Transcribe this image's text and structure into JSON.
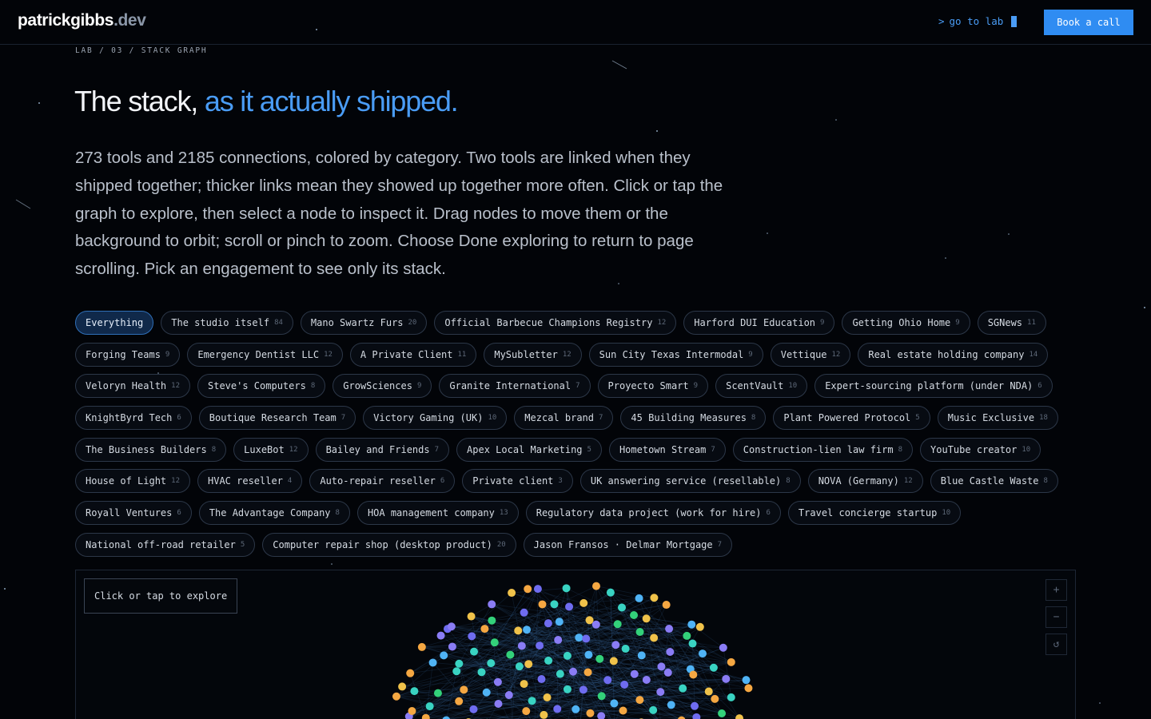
{
  "brand": {
    "name": "patrickgibbs",
    "tld": ".dev"
  },
  "nav": {
    "prompt": ">",
    "command": "go to lab",
    "cta": "Book a call"
  },
  "breadcrumb": "LAB / 03 / STACK GRAPH",
  "hero": {
    "title_main": "The stack, ",
    "title_accent": "as it actually shipped.",
    "description": "273 tools and 2185 connections, colored by category. Two tools are linked when they shipped together; thicker links mean they showed up together more often. Click or tap the graph to explore, then select a node to inspect it. Drag nodes to move them or the background to orbit; scroll or pinch to zoom. Choose Done exploring to return to page scrolling. Pick an engagement to see only its stack."
  },
  "filters": [
    {
      "label": "Everything",
      "count": "",
      "active": true
    },
    {
      "label": "The studio itself",
      "count": "84"
    },
    {
      "label": "Mano Swartz Furs",
      "count": "20"
    },
    {
      "label": "Official Barbecue Champions Registry",
      "count": "12"
    },
    {
      "label": "Harford DUI Education",
      "count": "9"
    },
    {
      "label": "Getting Ohio Home",
      "count": "9"
    },
    {
      "label": "SGNews",
      "count": "11"
    },
    {
      "label": "Forging Teams",
      "count": "9"
    },
    {
      "label": "Emergency Dentist LLC",
      "count": "12"
    },
    {
      "label": "A Private Client",
      "count": "11"
    },
    {
      "label": "MySubletter",
      "count": "12"
    },
    {
      "label": "Sun City Texas Intermodal",
      "count": "9"
    },
    {
      "label": "Vettique",
      "count": "12"
    },
    {
      "label": "Real estate holding company",
      "count": "14"
    },
    {
      "label": "Veloryn Health",
      "count": "12"
    },
    {
      "label": "Steve's Computers",
      "count": "8"
    },
    {
      "label": "GrowSciences",
      "count": "9"
    },
    {
      "label": "Granite International",
      "count": "7"
    },
    {
      "label": "Proyecto Smart",
      "count": "9"
    },
    {
      "label": "ScentVault",
      "count": "10"
    },
    {
      "label": "Expert-sourcing platform (under NDA)",
      "count": "6"
    },
    {
      "label": "KnightByrd Tech",
      "count": "6"
    },
    {
      "label": "Boutique Research Team",
      "count": "7"
    },
    {
      "label": "Victory Gaming (UK)",
      "count": "10"
    },
    {
      "label": "Mezcal brand",
      "count": "7"
    },
    {
      "label": "45 Building Measures",
      "count": "8"
    },
    {
      "label": "Plant Powered Protocol",
      "count": "5"
    },
    {
      "label": "Music Exclusive",
      "count": "18"
    },
    {
      "label": "The Business Builders",
      "count": "8"
    },
    {
      "label": "LuxeBot",
      "count": "12"
    },
    {
      "label": "Bailey and Friends",
      "count": "7"
    },
    {
      "label": "Apex Local Marketing",
      "count": "5"
    },
    {
      "label": "Hometown Stream",
      "count": "7"
    },
    {
      "label": "Construction-lien law firm",
      "count": "8"
    },
    {
      "label": "YouTube creator",
      "count": "10"
    },
    {
      "label": "House of Light",
      "count": "12"
    },
    {
      "label": "HVAC reseller",
      "count": "4"
    },
    {
      "label": "Auto-repair reseller",
      "count": "6"
    },
    {
      "label": "Private client",
      "count": "3"
    },
    {
      "label": "UK answering service (resellable)",
      "count": "8"
    },
    {
      "label": "NOVA (Germany)",
      "count": "12"
    },
    {
      "label": "Blue Castle Waste",
      "count": "8"
    },
    {
      "label": "Royall Ventures",
      "count": "6"
    },
    {
      "label": "The Advantage Company",
      "count": "8"
    },
    {
      "label": "HOA management company",
      "count": "13"
    },
    {
      "label": "Regulatory data project (work for hire)",
      "count": "6"
    },
    {
      "label": "Travel concierge startup",
      "count": "10"
    },
    {
      "label": "National off-road retailer",
      "count": "5"
    },
    {
      "label": "Computer repair shop (desktop product)",
      "count": "20"
    },
    {
      "label": "Jason Fransos · Delmar Mortgage",
      "count": "7"
    }
  ],
  "graph": {
    "explore_label": "Click or tap to explore",
    "zoom_in": "+",
    "zoom_out": "−",
    "reset": "↺",
    "category_colors": [
      "#8a7cf5",
      "#4fb3f5",
      "#39d3c2",
      "#33d17a",
      "#f5a742",
      "#f0c24a",
      "#6f6cf0"
    ]
  },
  "colors": {
    "accent": "#4a9cf5",
    "button": "#2f8cf2",
    "background": "#020408"
  }
}
